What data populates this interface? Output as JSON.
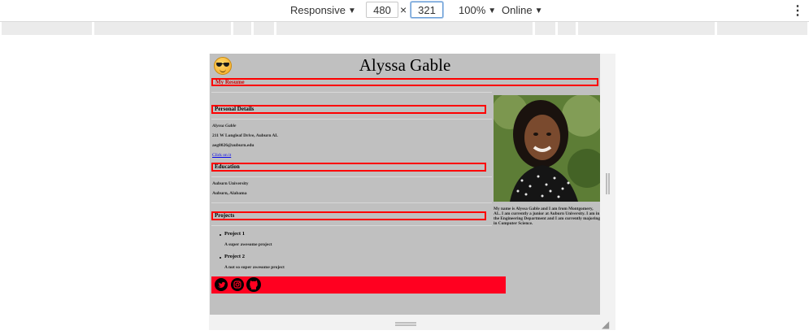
{
  "devtools": {
    "device_label": "Responsive",
    "width_value": "480",
    "height_value": "321",
    "times": "×",
    "zoom_label": "100%",
    "network_label": "Online",
    "more_icon": "more-vertical-icon"
  },
  "page": {
    "name": "Alyssa Gable",
    "resume_label": "My Resume",
    "emoji_icon": "sunglasses-emoji-icon",
    "personal": {
      "heading": "Personal Details",
      "fullname": "Alyssa Gable",
      "address": "211 W Longleaf Drive, Auburn AL",
      "email": "aeg0026@auburn.edu",
      "link_text": "Click on it"
    },
    "education": {
      "heading": "Education",
      "school": "Auburn University",
      "location": "Auburn, Alabama"
    },
    "projects": {
      "heading": "Projects",
      "items": [
        {
          "title": "Project 1",
          "desc": "A super awesome project"
        },
        {
          "title": "Project 2",
          "desc": "A not so super awesome project"
        }
      ]
    },
    "bio": "My name is Alyssa Gable and I am from Montgomery, AL. I am currently a junior at Auburn University. I am in the Engineering Department and I am currently majoring in Computer Science.",
    "social_icons": [
      "twitter-icon",
      "instagram-icon",
      "github-icon"
    ]
  },
  "colors": {
    "page_bg": "#c0c0c0",
    "accent_red": "#ff0000",
    "social_bar": "#ff0020",
    "link_blue": "#0000ee"
  }
}
